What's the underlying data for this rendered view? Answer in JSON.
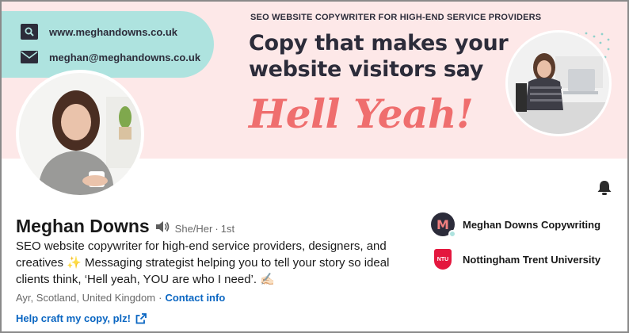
{
  "banner": {
    "website": "www.meghandowns.co.uk",
    "email": "meghan@meghandowns.co.uk",
    "tagline": "SEO WEBSITE COPYWRITER FOR HIGH-END SERVICE PROVIDERS",
    "headline": "Copy that makes your website visitors say",
    "big_text": "Hell Yeah!",
    "colors": {
      "background": "#fde8e8",
      "pill": "#aee3df",
      "accent": "#ef6e6e",
      "dark": "#2c2c3a"
    }
  },
  "profile": {
    "name": "Meghan Downs",
    "pronouns": "She/Her",
    "separator": "·",
    "degree": "1st",
    "headline": "SEO website copywriter for high-end service providers, designers, and creatives ✨ Messaging strategist helping you to tell your story so ideal clients think, ‘Hell yeah, YOU are who I need’. ✍🏻",
    "location": "Ayr, Scotland, United Kingdom",
    "location_sep": "·",
    "contact_info_label": "Contact info",
    "custom_link_label": "Help craft my copy, plz!"
  },
  "organizations": [
    {
      "name": "Meghan Downs Copywriting",
      "logo_text": "M",
      "logo_color": "#2c2c3a"
    },
    {
      "name": "Nottingham Trent University",
      "logo_text": "NTU",
      "logo_color": "#e4173e"
    }
  ],
  "icons": {
    "search": "search-icon",
    "mail": "mail-icon",
    "speaker": "speaker-icon",
    "bell": "bell-icon",
    "external_link": "external-link-icon"
  },
  "link_color": "#0a66c2"
}
